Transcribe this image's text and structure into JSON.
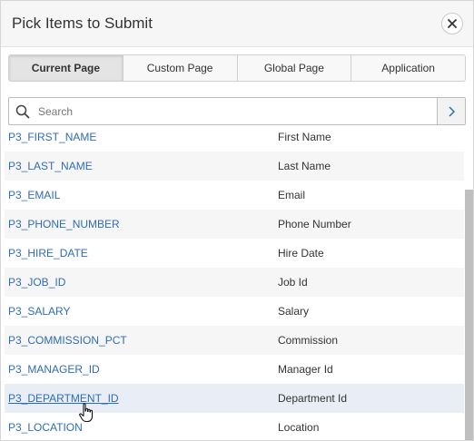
{
  "dialog": {
    "title": "Pick Items to Submit",
    "close_icon": "close-icon"
  },
  "tabs": [
    {
      "label": "Current Page",
      "active": true
    },
    {
      "label": "Custom Page",
      "active": false
    },
    {
      "label": "Global Page",
      "active": false
    },
    {
      "label": "Application",
      "active": false
    }
  ],
  "search": {
    "placeholder": "Search",
    "value": "",
    "icon": "search-icon",
    "go_icon": "chevron-right-icon"
  },
  "items": [
    {
      "name": "P3_FIRST_NAME",
      "label": "First Name"
    },
    {
      "name": "P3_LAST_NAME",
      "label": "Last Name"
    },
    {
      "name": "P3_EMAIL",
      "label": "Email"
    },
    {
      "name": "P3_PHONE_NUMBER",
      "label": "Phone Number"
    },
    {
      "name": "P3_HIRE_DATE",
      "label": "Hire Date"
    },
    {
      "name": "P3_JOB_ID",
      "label": "Job Id"
    },
    {
      "name": "P3_SALARY",
      "label": "Salary"
    },
    {
      "name": "P3_COMMISSION_PCT",
      "label": "Commission"
    },
    {
      "name": "P3_MANAGER_ID",
      "label": "Manager Id"
    },
    {
      "name": "P3_DEPARTMENT_ID",
      "label": "Department Id"
    },
    {
      "name": "P3_LOCATION",
      "label": "Location"
    }
  ],
  "hovered_item": "P3_DEPARTMENT_ID",
  "colors": {
    "link": "#2f6db5",
    "row_alt": "#f6f6f6",
    "row_hover": "#e9eef6"
  }
}
